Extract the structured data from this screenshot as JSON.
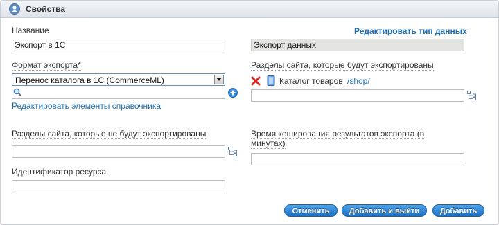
{
  "panel": {
    "title": "Свойства"
  },
  "fields": {
    "name": {
      "label": "Название",
      "value": "Экспорт в 1С"
    },
    "data_type": {
      "link": "Редактировать тип данных",
      "value": "Экспорт данных"
    },
    "export_format": {
      "label": "Формат экспорта",
      "required_mark": "*",
      "selected": "Перенос каталога в 1С (CommerceML)",
      "search_value": "",
      "edit_link": "Редактировать элементы справочника"
    },
    "exported_sections": {
      "label": "Разделы сайта, которые будут экспортированы",
      "items": [
        {
          "name": "Каталог товаров",
          "path": "/shop/"
        }
      ],
      "value": ""
    },
    "not_exported_sections": {
      "label": "Разделы сайта, которые не будут экспортированы",
      "value": ""
    },
    "cache_time": {
      "label": "Время кеширования результатов экспорта (в минутах)",
      "label_line1": "Время кеширования результатов экспорта (в",
      "label_line2": "минутах)",
      "value": ""
    },
    "resource_id": {
      "label": "Идентификатор ресурса",
      "value": ""
    }
  },
  "buttons": {
    "cancel": "Отменить",
    "add_and_exit": "Добавить и выйти",
    "add": "Добавить"
  },
  "colors": {
    "accent": "#1a6fb5",
    "button": "#2f86d6",
    "delete": "#d9261c"
  }
}
